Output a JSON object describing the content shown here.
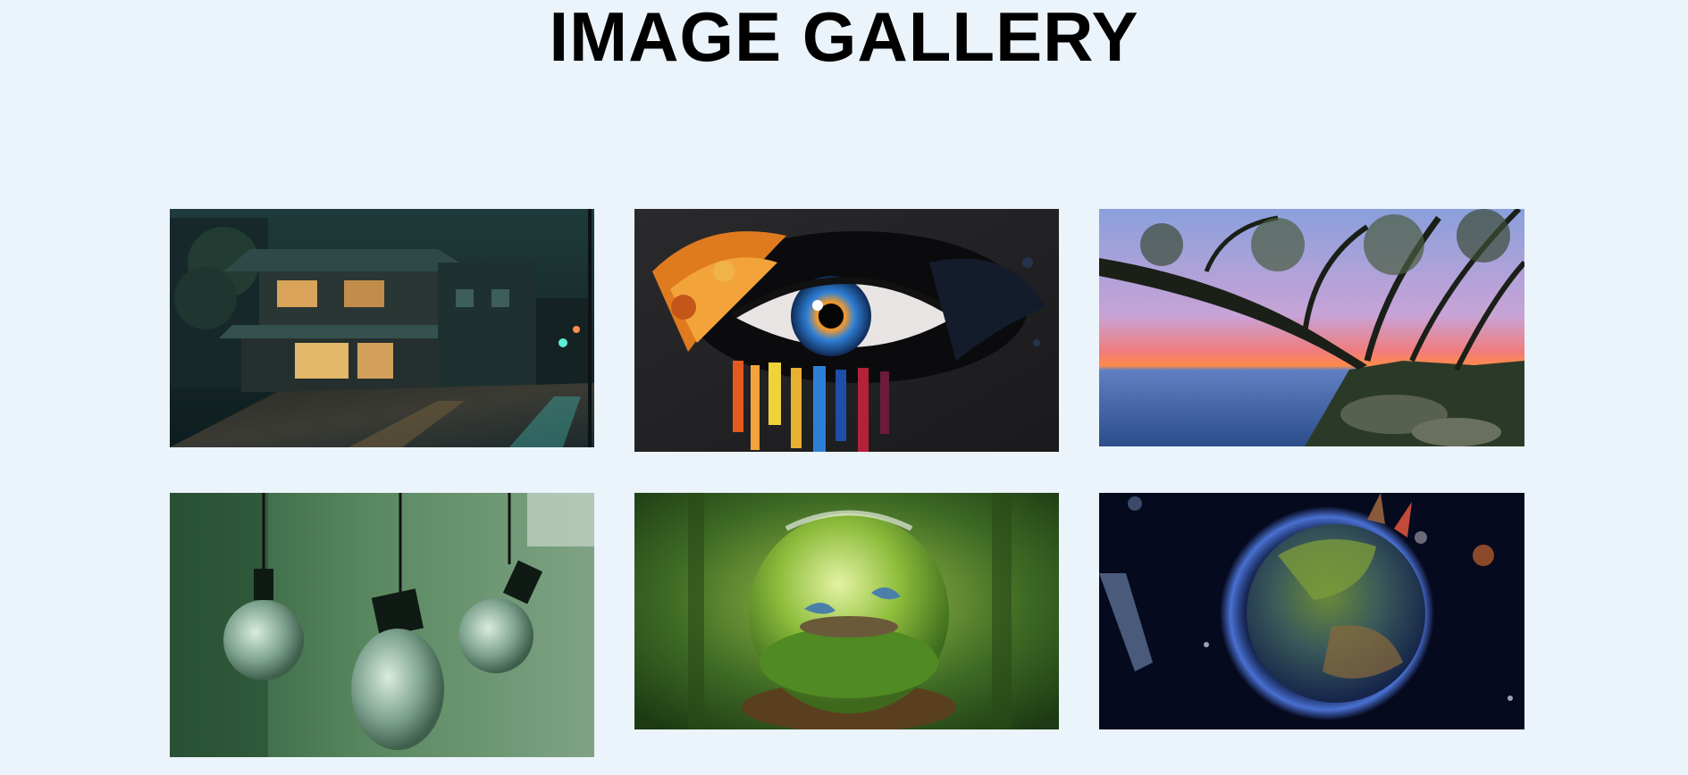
{
  "header": {
    "title": "IMAGE GALLERY"
  },
  "colors": {
    "background": "#ebf3fb",
    "title": "#000000"
  },
  "gallery": {
    "images": [
      {
        "subject": "rainy-night-street-houses"
      },
      {
        "subject": "colorful-paint-eye"
      },
      {
        "subject": "lakeside-tree-sunset"
      },
      {
        "subject": "hanging-glass-bulbs"
      },
      {
        "subject": "forest-glass-sphere-birds"
      },
      {
        "subject": "planet-earth-space"
      }
    ]
  }
}
